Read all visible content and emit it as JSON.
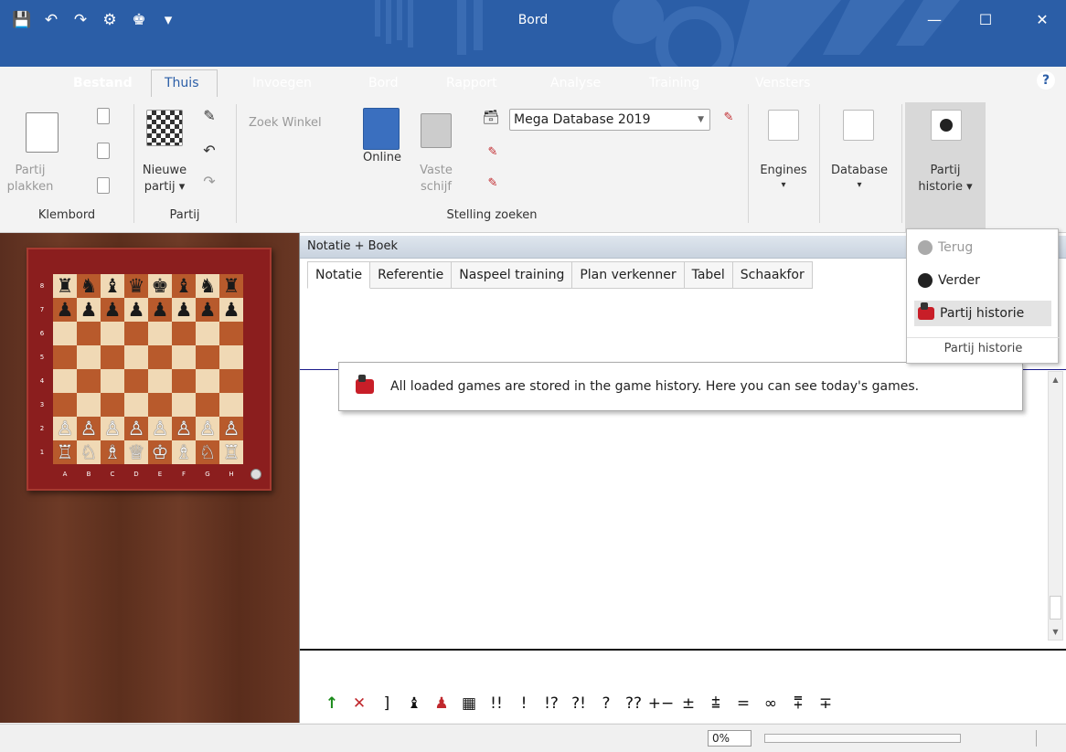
{
  "window": {
    "title": "Bord",
    "quick_access": [
      "save-icon",
      "undo-icon",
      "redo-icon",
      "engine-icon",
      "king-icon",
      "customize-icon"
    ],
    "buttons": [
      "minimize",
      "maximize",
      "close"
    ]
  },
  "ribbon_tabs": [
    "Bestand",
    "Thuis",
    "Invoegen",
    "Bord",
    "Rapport",
    "Analyse",
    "Training",
    "Vensters"
  ],
  "active_tab": "Thuis",
  "ribbon": {
    "klembord": {
      "paste_line1": "Partij",
      "paste_line2": "plakken",
      "label": "Klembord"
    },
    "partij": {
      "new_line1": "Nieuwe",
      "new_line2": "partij ▾",
      "label": "Partij"
    },
    "stelling": {
      "shop": "Zoek Winkel",
      "online": "Online",
      "disk_line1": "Vaste",
      "disk_line2": "schijf",
      "database_select": "Mega Database 2019",
      "label": "Stelling zoeken"
    },
    "engines": {
      "label": "Engines",
      "arrow": "▾"
    },
    "database": {
      "label": "Database",
      "arrow": "▾"
    },
    "history": {
      "line1": "Partij",
      "line2": "historie ▾"
    }
  },
  "notation": {
    "pane_title": "Notatie + Boek",
    "subtabs": [
      "Notatie",
      "Referentie",
      "Naspeel training",
      "Plan verkenner",
      "Tabel",
      "Schaakfor"
    ],
    "active_subtab": "Notatie"
  },
  "tooltip": {
    "text": "All loaded games are stored in the game history. Here you can see today's games."
  },
  "dropdown": {
    "items": [
      {
        "label": "Terug",
        "enabled": false
      },
      {
        "label": "Verder",
        "enabled": true
      },
      {
        "label": "Partij historie",
        "enabled": true,
        "highlighted": true
      }
    ],
    "footer": "Partij historie"
  },
  "board": {
    "ranks": [
      "8",
      "7",
      "6",
      "5",
      "4",
      "3",
      "2",
      "1"
    ],
    "files": [
      "A",
      "B",
      "C",
      "D",
      "E",
      "F",
      "G",
      "H"
    ],
    "position": [
      [
        "♜",
        "♞",
        "♝",
        "♛",
        "♚",
        "♝",
        "♞",
        "♜"
      ],
      [
        "♟",
        "♟",
        "♟",
        "♟",
        "♟",
        "♟",
        "♟",
        "♟"
      ],
      [
        "",
        "",
        "",
        "",
        "",
        "",
        "",
        ""
      ],
      [
        "",
        "",
        "",
        "",
        "",
        "",
        "",
        ""
      ],
      [
        "",
        "",
        "",
        "",
        "",
        "",
        "",
        ""
      ],
      [
        "",
        "",
        "",
        "",
        "",
        "",
        "",
        ""
      ],
      [
        "♙",
        "♙",
        "♙",
        "♙",
        "♙",
        "♙",
        "♙",
        "♙"
      ],
      [
        "♖",
        "♘",
        "♗",
        "♕",
        "♔",
        "♗",
        "♘",
        "♖"
      ]
    ]
  },
  "symbols": [
    "↑",
    "✕",
    "]",
    "♝",
    "♟",
    "▦",
    "!!",
    "!",
    "!?",
    "?!",
    "?",
    "??",
    "+−",
    "±",
    "⩲",
    "=",
    "∞",
    "⩱",
    "∓"
  ],
  "status": {
    "percent": "0%",
    "progress": 0
  }
}
